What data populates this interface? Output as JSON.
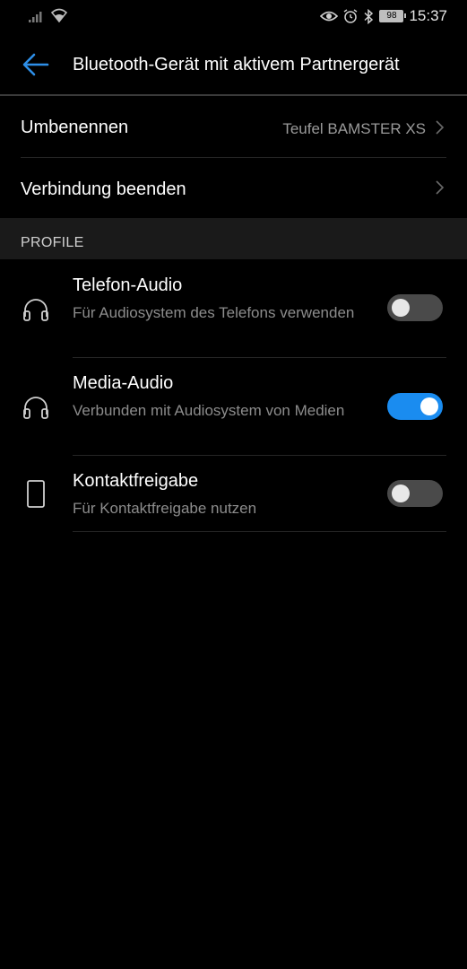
{
  "status_bar": {
    "time": "15:37",
    "battery": "98",
    "icons": [
      "signal-icon",
      "wifi-icon",
      "eye-icon",
      "alarm-icon",
      "bluetooth-icon",
      "battery-icon"
    ]
  },
  "app_bar": {
    "title": "Bluetooth-Gerät mit aktivem Partnergerät",
    "back_icon": "arrow-left-icon"
  },
  "settings": {
    "rename_label": "Umbenennen",
    "rename_value": "Teufel BAMSTER XS",
    "disconnect_label": "Verbindung beenden"
  },
  "profiles": {
    "header": "PROFILE",
    "items": [
      {
        "title": "Telefon-Audio",
        "subtitle": "Für Audiosystem des Telefons verwenden",
        "icon": "headphones-icon",
        "enabled": false
      },
      {
        "title": "Media-Audio",
        "subtitle": "Verbunden mit  Audiosystem von Medien",
        "icon": "headphones-icon",
        "enabled": true
      },
      {
        "title": "Kontaktfreigabe",
        "subtitle": "Für Kontaktfreigabe nutzen",
        "icon": "phone-icon",
        "enabled": false
      }
    ]
  },
  "colors": {
    "background": "#000000",
    "accent": "#1a8cf0",
    "section_bg": "#1a1a1a",
    "secondary_text": "#8c8c8c"
  }
}
